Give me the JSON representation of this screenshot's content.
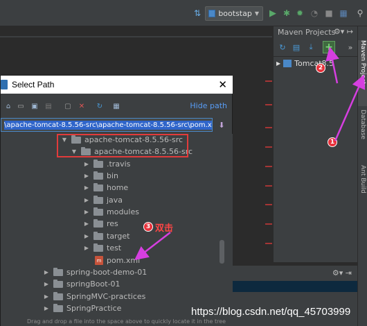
{
  "toolbar": {
    "run_config_label": "bootstap"
  },
  "maven": {
    "title": "Maven Projects",
    "project_name": "Tomcat8.5"
  },
  "right_strip": {
    "tabs": [
      "Maven Projects",
      "Database",
      "Ant Build"
    ]
  },
  "dialog": {
    "title": "Select Path",
    "hide_path": "Hide path",
    "path_value": "\\apache-tomcat-8.5.56-src\\apache-tomcat-8.5.56-src\\pom.xml",
    "footer": "Drag and drop a file into the space above to quickly locate it in the tree",
    "tree": [
      {
        "label": "apache-tomcat-8.5.56-src",
        "expanded": true,
        "type": "folder"
      },
      {
        "label": "apache-tomcat-8.5.56-src",
        "expanded": true,
        "type": "folder"
      },
      {
        "label": ".travis",
        "expanded": false,
        "type": "folder"
      },
      {
        "label": "bin",
        "expanded": false,
        "type": "folder"
      },
      {
        "label": "home",
        "expanded": false,
        "type": "folder"
      },
      {
        "label": "java",
        "expanded": false,
        "type": "folder"
      },
      {
        "label": "modules",
        "expanded": false,
        "type": "folder"
      },
      {
        "label": "res",
        "expanded": false,
        "type": "folder"
      },
      {
        "label": "target",
        "expanded": false,
        "type": "folder"
      },
      {
        "label": "test",
        "expanded": false,
        "type": "folder"
      },
      {
        "label": "pom.xml",
        "expanded": null,
        "type": "file"
      },
      {
        "label": "spring-boot-demo-01",
        "expanded": false,
        "type": "folder"
      },
      {
        "label": "springBoot-01",
        "expanded": false,
        "type": "folder"
      },
      {
        "label": "SpringMVC-practices",
        "expanded": false,
        "type": "folder"
      },
      {
        "label": "SpringPractice",
        "expanded": false,
        "type": "folder"
      }
    ]
  },
  "annotations": {
    "step1": "1",
    "step2": "2",
    "step3": "3",
    "step3_text": "双击",
    "accent_color": "#e23b3b",
    "arrow_color": "#d63fe0"
  },
  "watermark": "https://blog.csdn.net/qq_45703999"
}
